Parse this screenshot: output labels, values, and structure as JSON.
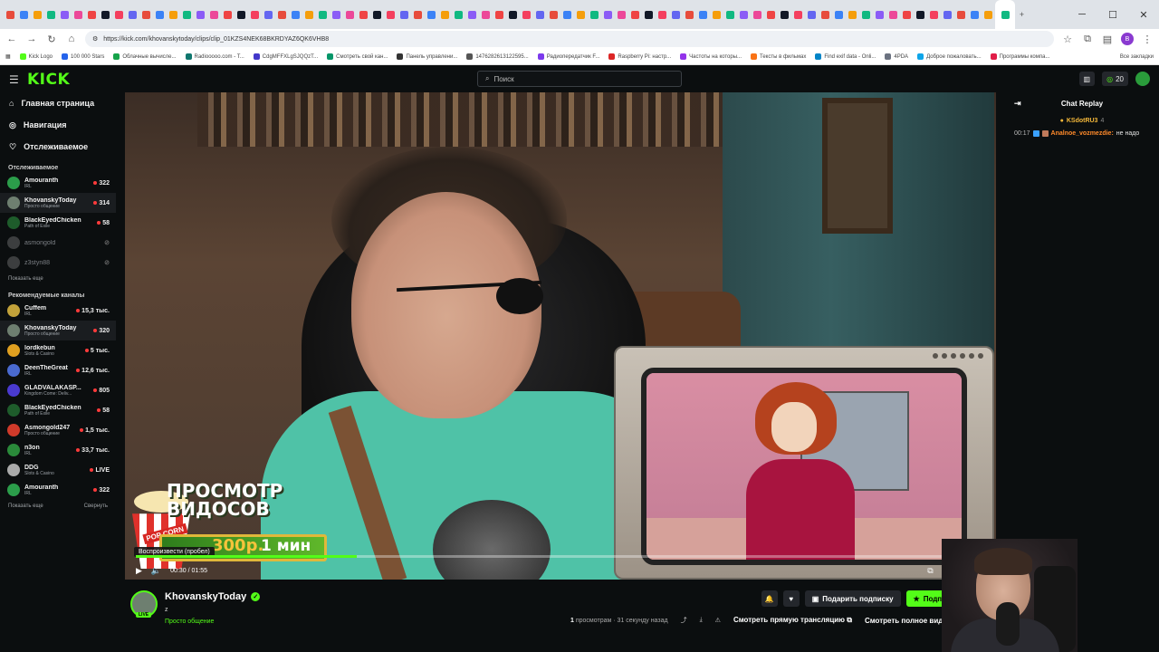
{
  "browser": {
    "url": "https://kick.com/khovanskytoday/clips/clip_01KZS4NEK68BKRDYAZ6QK6VHB8",
    "bookmarks": [
      "Kick Logo",
      "100 000 Stars",
      "Облачные вычисле...",
      "Radiooooo.com - T...",
      "CdgMFFXLgSJQQzT...",
      "Смотреть свой кан...",
      "Панель управлени...",
      "1476282613122595...",
      "Радиопередатчик F...",
      "Raspberry Pi: настр...",
      "Частоты на которы...",
      "Тексты в фильмах",
      "Find exif data - Onli...",
      "4PDA",
      "Доброе пожаловать...",
      "Программы компа..."
    ],
    "all_bookmarks": "Все закладки",
    "profile_letter": "B"
  },
  "header": {
    "logo": "KICK",
    "search_placeholder": "Поиск",
    "points": "20"
  },
  "sidebar": {
    "nav": [
      {
        "label": "Главная страница",
        "icon": "home-icon"
      },
      {
        "label": "Навигация",
        "icon": "compass-icon"
      },
      {
        "label": "Отслеживаемое",
        "icon": "heart-icon"
      }
    ],
    "following_title": "Отслеживаемое",
    "following": [
      {
        "name": "Amouranth",
        "sub": "IRL",
        "count": "322",
        "color": "#2b9d4a"
      },
      {
        "name": "KhovanskyToday",
        "sub": "Просто общение",
        "count": "314",
        "color": "#6e7f70"
      },
      {
        "name": "BlackEyedChicken",
        "sub": "Path of Exile",
        "count": "58",
        "color": "#1e5c2b"
      },
      {
        "name": "asmongold",
        "sub": "",
        "count": "",
        "color": "#888888"
      },
      {
        "name": "z3styn88",
        "sub": "",
        "count": "",
        "color": "#888888"
      }
    ],
    "show_more": "Показать еще",
    "recommended_title": "Рекомендуемые каналы",
    "recommended": [
      {
        "name": "Cuffem",
        "sub": "IRL",
        "count": "15,3 тыс.",
        "color": "#c2a23a"
      },
      {
        "name": "KhovanskyToday",
        "sub": "Просто общение",
        "count": "320",
        "color": "#6e7f70"
      },
      {
        "name": "lordkebun",
        "sub": "Slots & Casino",
        "count": "5 тыс.",
        "color": "#e0a020"
      },
      {
        "name": "DeenTheGreat",
        "sub": "IRL",
        "count": "12,6 тыс.",
        "color": "#4a6ad0"
      },
      {
        "name": "GLADVALAKASP...",
        "sub": "Kingdom Come: Deliv...",
        "count": "805",
        "color": "#4a3ad0"
      },
      {
        "name": "BlackEyedChicken",
        "sub": "Path of Exile",
        "count": "58",
        "color": "#1e5c2b"
      },
      {
        "name": "Asmongold247",
        "sub": "Просто общение",
        "count": "1,5 тыс.",
        "color": "#d03a2a"
      },
      {
        "name": "n3on",
        "sub": "IRL",
        "count": "33,7 тыс.",
        "color": "#2a8a3a"
      },
      {
        "name": "DDG",
        "sub": "Slots & Casino",
        "count": "LIVE",
        "color": "#aaaaaa"
      },
      {
        "name": "Amouranth",
        "sub": "IRL",
        "count": "322",
        "color": "#2b9d4a"
      }
    ],
    "show_more_2": "Показать еще",
    "collapse": "Свернуть"
  },
  "player": {
    "promo_title": "ПРОСМОТР\nВИДОСОВ",
    "promo_price": "300р.",
    "promo_time": "1 мин",
    "popcorn": "POP CORN",
    "tooltip": "Воспроизвести (пробел)",
    "time": "00:30 / 01:55",
    "progress": 0.26
  },
  "chat": {
    "title": "Chat Replay",
    "pinned_user": "KSdotRU3",
    "pinned_count": "4",
    "messages": [
      {
        "time": "00:17",
        "user": "Analnoe_vozmezdie",
        "text": "не надо"
      }
    ]
  },
  "info": {
    "channel": "KhovanskyToday",
    "clip_title": "z",
    "category": "Просто общение",
    "live": "LIVE",
    "views_count": "1",
    "views_label": "просмотрам",
    "time_ago": "31 секунду назад",
    "gift_sub": "Подарить подписку",
    "subscribe": "Подписаться",
    "watch_live": "Смотреть прямую трансляцию",
    "watch_full": "Смотреть полное видео"
  }
}
